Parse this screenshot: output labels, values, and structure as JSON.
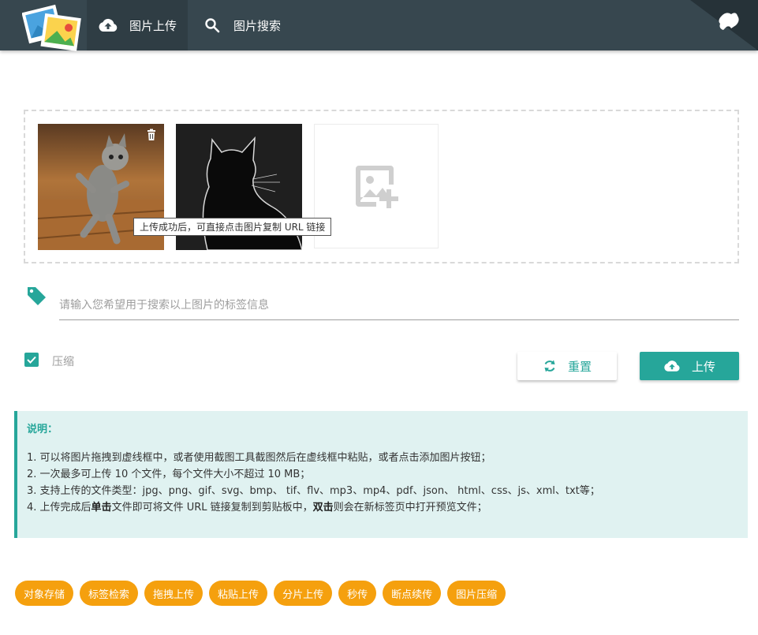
{
  "nav": {
    "upload_label": "图片上传",
    "search_label": "图片搜索"
  },
  "upload": {
    "tooltip": "上传成功后，可直接点击图片复制 URL 链接"
  },
  "tags": {
    "placeholder": "请输入您希望用于搜索以上图片的标签信息"
  },
  "options": {
    "compress_label": "压缩",
    "compress_checked": true
  },
  "actions": {
    "reset_label": "重置",
    "upload_label": "上传"
  },
  "notes": {
    "title": "说明：",
    "line1": "1. 可以将图片拖拽到虚线框中，或者使用截图工具截图然后在虚线框中粘贴，或者点击添加图片按钮；",
    "line2": "2. 一次最多可上传 10 个文件，每个文件大小不超过 10 MB；",
    "line3": "3. 支持上传的文件类型：jpg、png、gif、svg、bmp、 tif、flv、mp3、mp4、pdf、json、 html、css、js、xml、txt等；",
    "line4_a": "4. 上传完成后",
    "line4_b": "单击",
    "line4_c": "文件即可将文件 URL 链接复制到剪贴板中，",
    "line4_d": "双击",
    "line4_e": "则会在新标签页中打开预览文件；"
  },
  "chips": [
    "对象存储",
    "标签检索",
    "拖拽上传",
    "粘贴上传",
    "分片上传",
    "秒传",
    "断点续传",
    "图片压缩"
  ],
  "colors": {
    "navbar": "#37474f",
    "accent": "#26a69a",
    "chip": "#f5a00e",
    "notes_bg": "#e0f2f1"
  }
}
